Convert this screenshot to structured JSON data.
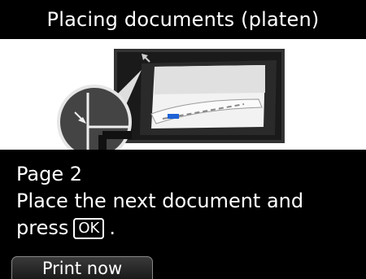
{
  "header": {
    "title": "Placing documents (platen)"
  },
  "illustration": {
    "icon": "platen-document-icon"
  },
  "message": {
    "line1": "Page 2",
    "line2": "Place the next document and",
    "line3_prefix": "press",
    "ok_key": "OK",
    "line3_suffix": "."
  },
  "footer": {
    "print_now_label": "Print now"
  }
}
